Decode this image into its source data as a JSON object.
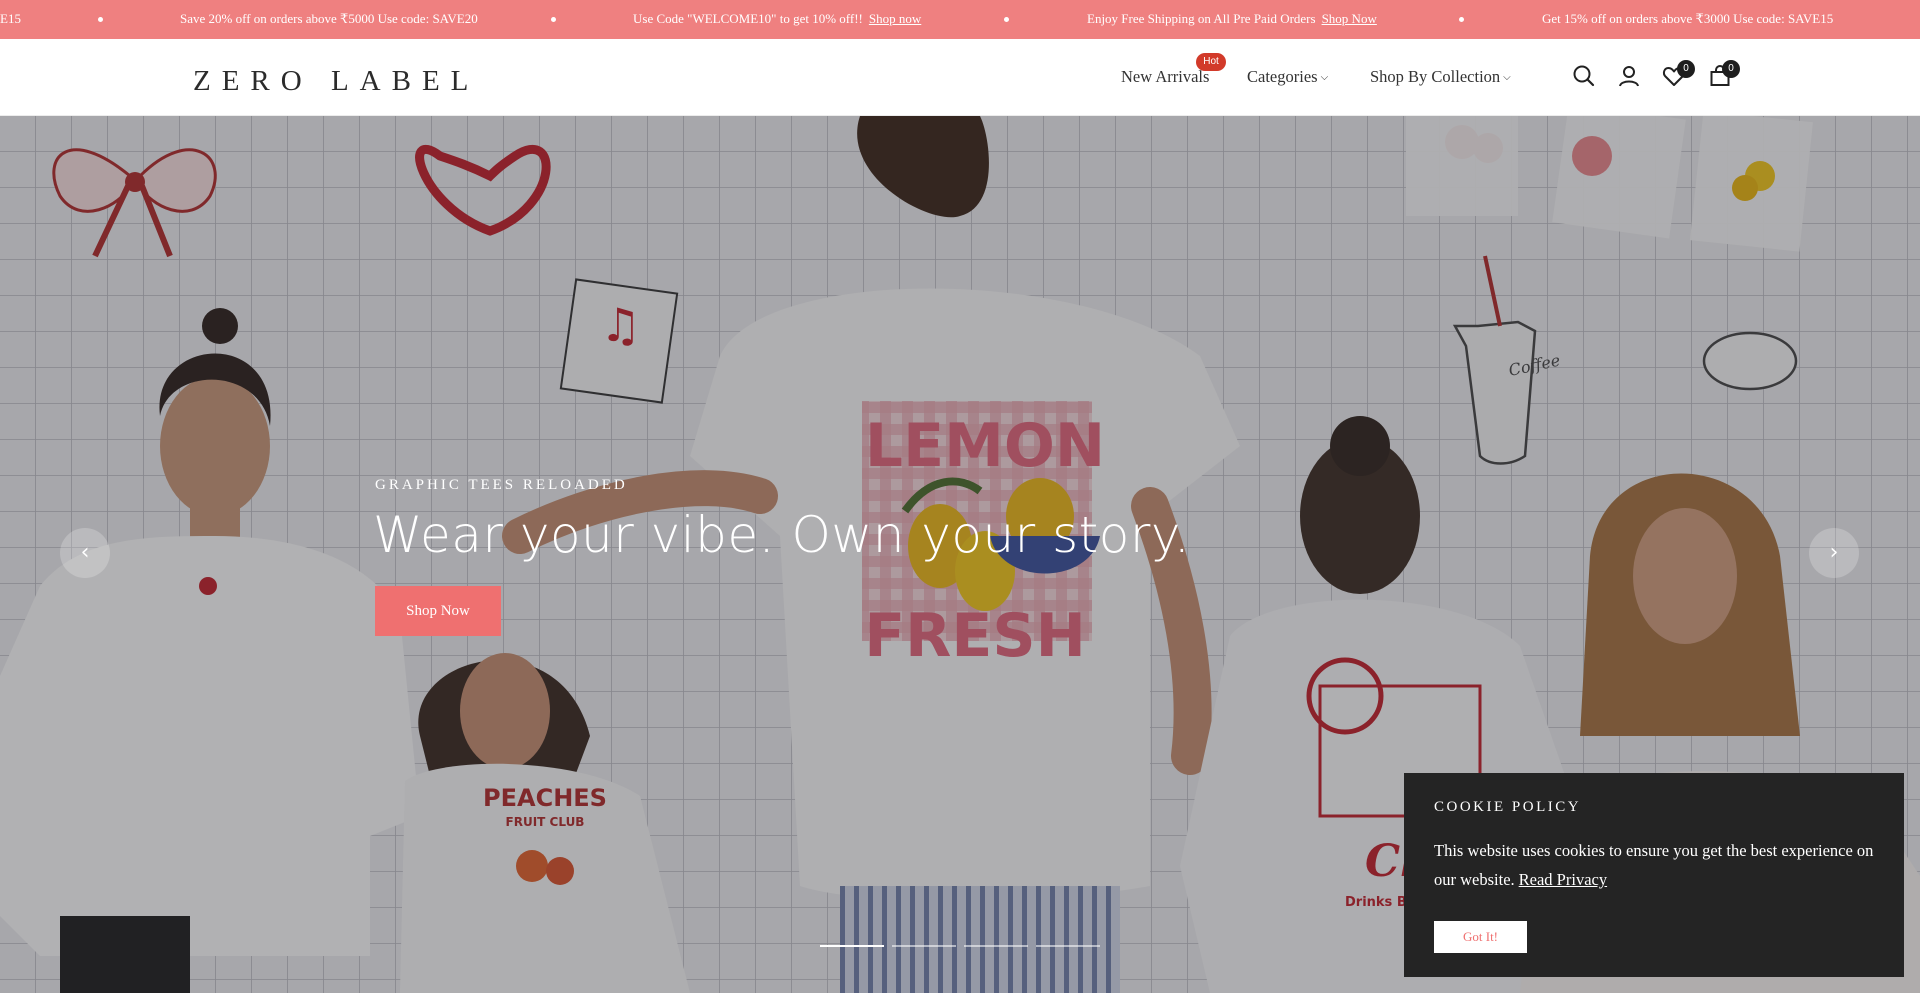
{
  "announcement_bar": {
    "background": "#ef8080",
    "messages": [
      {
        "text": "E15",
        "link": ""
      },
      {
        "text": "Save 20% off on orders above ₹5000 Use code: SAVE20",
        "link": ""
      },
      {
        "text": "Use Code \"WELCOME10\" to get 10% off!!",
        "link": "Shop now"
      },
      {
        "text": "Enjoy Free Shipping on All Pre Paid Orders",
        "link": "Shop Now"
      },
      {
        "text": "Get 15% off on orders above ₹3000 Use code: SAVE15",
        "link": ""
      }
    ]
  },
  "header": {
    "logo": "ZERO LABEL",
    "nav": [
      {
        "label": "New Arrivals",
        "badge": "Hot"
      },
      {
        "label": "Categories"
      },
      {
        "label": "Shop By Collection"
      }
    ],
    "icons": [
      "search-icon",
      "account-icon",
      "wishlist-icon",
      "cart-icon"
    ],
    "wishlist_count": "0",
    "cart_count": "0"
  },
  "hero": {
    "kicker": "GRAPHIC TEES RELOADED",
    "headline": "Wear your vibe. Own your story.",
    "cta": "Shop Now",
    "slide_count": 4,
    "active_slide": 1,
    "accent": "#ef7070",
    "tee_prints": {
      "center_top": "LEMON",
      "center_bottom": "FRESH",
      "peaches_top": "PEACHES",
      "peaches_bottom": "FRUIT CLUB",
      "cherry": "Cherry Bo",
      "cherry_sub": "Drinks By Brit",
      "cup": "Coffee"
    }
  },
  "cookie_banner": {
    "title": "COOKIE POLICY",
    "text": "This website uses cookies to ensure you get the best experience on our website.",
    "link": "Read Privacy",
    "button": "Got It!"
  }
}
